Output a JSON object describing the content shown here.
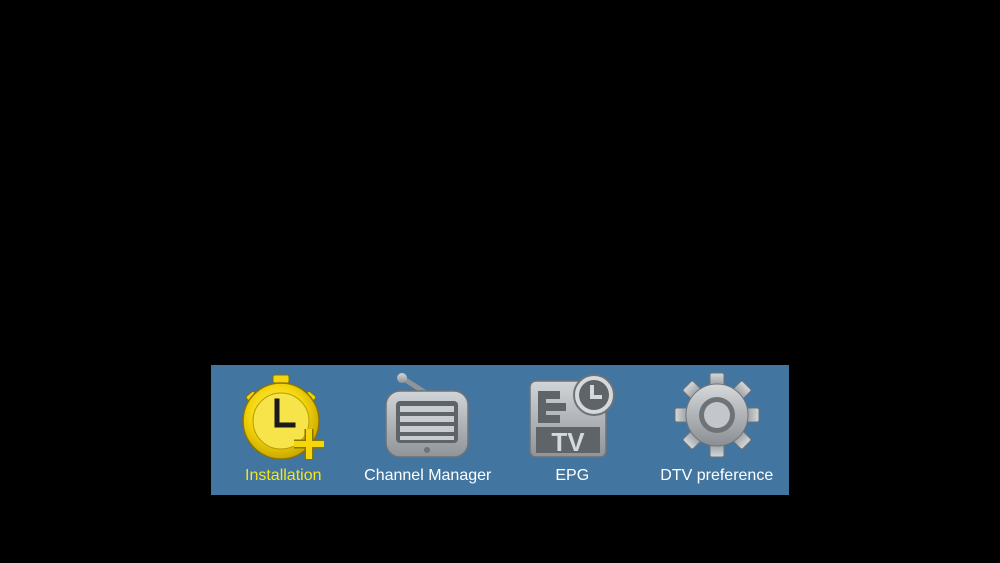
{
  "menu": {
    "items": [
      {
        "label": "Installation",
        "icon": "stopwatch-plus-icon",
        "selected": true
      },
      {
        "label": "Channel Manager",
        "icon": "tv-list-icon",
        "selected": false
      },
      {
        "label": "EPG",
        "icon": "epg-tv-clock-icon",
        "selected": false
      },
      {
        "label": "DTV preference",
        "icon": "gear-icon",
        "selected": false
      }
    ]
  },
  "colors": {
    "background": "#000000",
    "menu_bar": "#4275a0",
    "selected_label": "#f2e522",
    "label": "#ffffff",
    "icon_gray": "#a8acb0",
    "icon_yellow": "#f5d60c"
  }
}
